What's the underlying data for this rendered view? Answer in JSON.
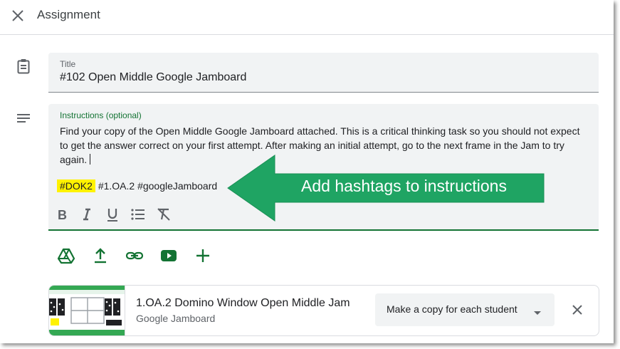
{
  "header": {
    "title": "Assignment",
    "close_icon": "close-icon"
  },
  "form": {
    "title_field": {
      "label": "Title",
      "value": "#102 Open Middle Google Jamboard"
    },
    "instructions_field": {
      "label": "Instructions (optional)",
      "value": "Find your copy of the Open Middle Google Jamboard attached. This is a critical thinking task so you should not expect to get the answer correct on your first attempt. After making an initial attempt, go to the next frame in the Jam to try again.",
      "hashtag_highlighted": "#DOK2",
      "hashtags_rest": "#1.OA.2 #googleJamboard"
    },
    "format_toolbar": [
      "bold-icon",
      "italic-icon",
      "underline-icon",
      "bulleted-list-icon",
      "clear-formatting-icon"
    ],
    "attach_toolbar": [
      "google-drive-icon",
      "upload-icon",
      "link-icon",
      "youtube-icon",
      "add-icon"
    ]
  },
  "annotation": {
    "text": "Add hashtags to instructions",
    "color": "#1fa463"
  },
  "attachment": {
    "title": "1.OA.2 Domino Window Open Middle Jam",
    "type": "Google Jamboard",
    "share_option": "Make a copy for each student",
    "remove_icon": "close-icon"
  },
  "colors": {
    "accent_green": "#137333",
    "highlight_yellow": "#fff200",
    "field_bg": "#f1f3f4"
  }
}
